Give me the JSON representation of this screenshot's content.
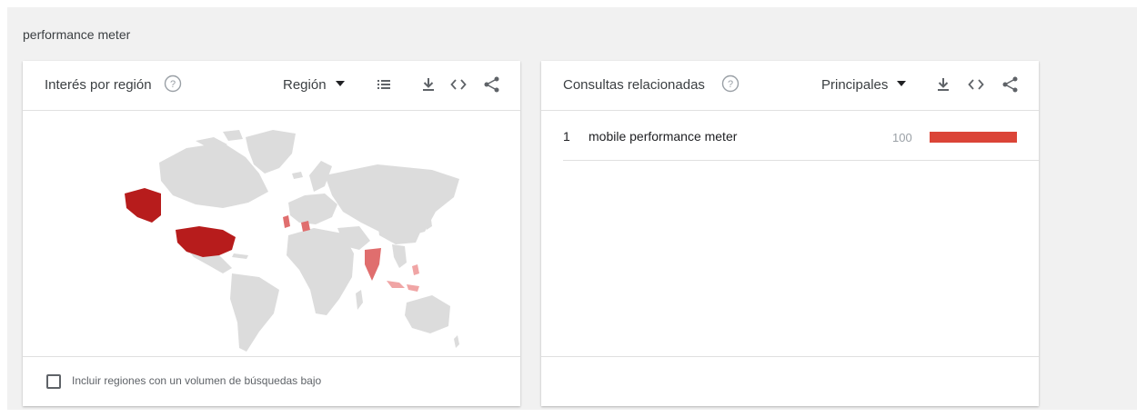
{
  "search_term": "performance meter",
  "interest_by_region": {
    "title": "Interés por región",
    "resolution_select": "Región",
    "low_volume_checkbox": {
      "label": "Incluir regiones con un volumen de búsquedas bajo",
      "checked": false
    },
    "map_colors": {
      "no_data": "#dcdcdc",
      "high": "#b71c1c",
      "medium": "#e06e6e",
      "low": "#f0a5a5"
    }
  },
  "related_queries": {
    "title": "Consultas relacionadas",
    "type_select": "Principales",
    "items": [
      {
        "rank": "1",
        "query": "mobile performance meter",
        "value": "100",
        "value_fraction": 1.0
      }
    ],
    "bar_color": "#db4437"
  },
  "icons": {
    "help": "help-circle-icon",
    "list": "list-icon",
    "download": "download-icon",
    "embed": "embed-code-icon",
    "share": "share-icon"
  }
}
